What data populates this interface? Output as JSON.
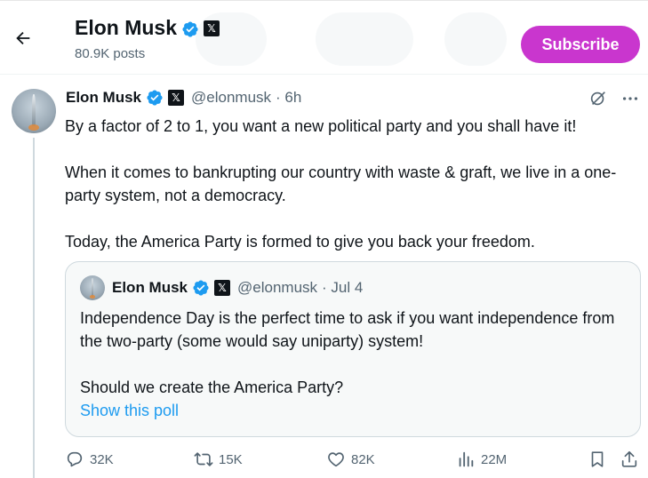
{
  "header": {
    "name": "Elon Musk",
    "post_count": "80.9K posts",
    "subscribe_label": "Subscribe"
  },
  "tweet": {
    "name": "Elon Musk",
    "handle": "@elonmusk",
    "time": "· 6h",
    "paragraphs": [
      "By a factor of 2 to 1, you want a new political party and you shall have it!",
      "When it comes to bankrupting our country with waste & graft, we live in a one-party system, not a democracy.",
      "Today, the America Party is formed to give you back your freedom."
    ]
  },
  "quote": {
    "name": "Elon Musk",
    "handle": "@elonmusk",
    "time": "· Jul 4",
    "paragraphs": [
      "Independence Day is the perfect time to ask if you want independence from the two-party (some would say uniparty) system!",
      "Should we create the America Party?"
    ],
    "poll_link": "Show this poll"
  },
  "actions": {
    "replies": "32K",
    "reposts": "15K",
    "likes": "82K",
    "views": "22M"
  },
  "icons": {
    "back": "arrow-left-icon",
    "verified": "verified-badge-icon",
    "affiliate": "x-logo-icon",
    "grok": "grok-icon",
    "more": "more-icon",
    "reply": "reply-icon",
    "repost": "repost-icon",
    "like": "heart-icon",
    "views": "views-icon",
    "bookmark": "bookmark-icon",
    "share": "share-icon"
  },
  "colors": {
    "accent": "#1d9bf0",
    "subscribe": "#c936ce",
    "secondary_text": "#536471"
  }
}
